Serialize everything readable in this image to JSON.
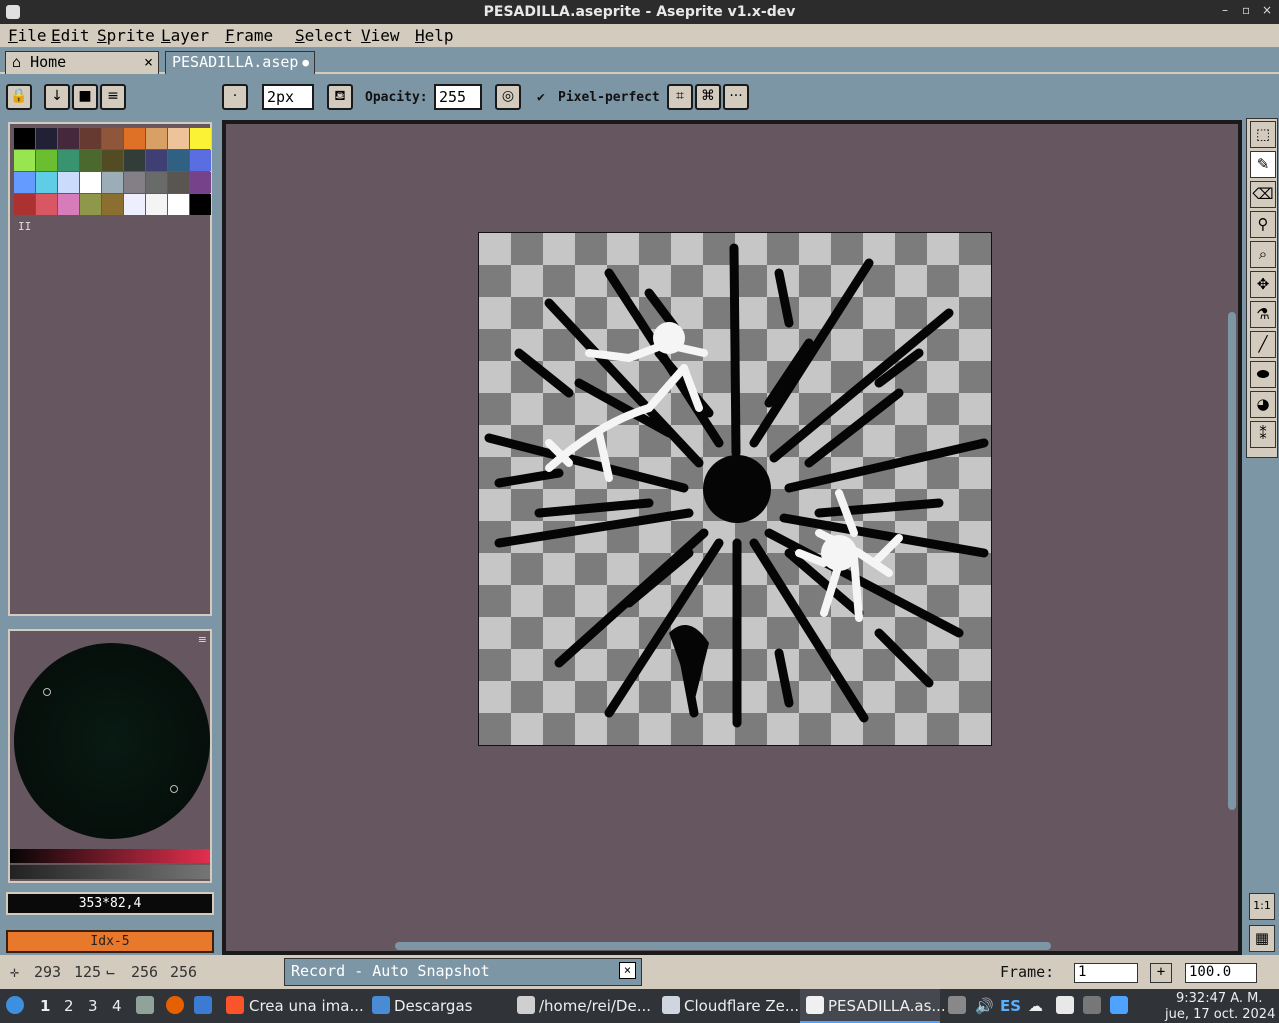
{
  "window": {
    "title": "PESADILLA.aseprite - Aseprite v1.x-dev",
    "min": "–",
    "max": "▫",
    "close": "×"
  },
  "menu": [
    "File",
    "Edit",
    "Sprite",
    "Layer",
    "Frame",
    "Select",
    "View",
    "Help"
  ],
  "tabs": {
    "home": "Home",
    "home_close": "×",
    "file": "PESADILLA.asep",
    "file_dot": "●"
  },
  "toolbar": {
    "brush_size": "2px",
    "opacity_label": "Opacity:",
    "opacity_value": "255",
    "pixel_perfect_check": "✔",
    "pixel_perfect": "Pixel-perfect",
    "more": "···"
  },
  "palette": {
    "colors": [
      "#000000",
      "#222034",
      "#45283c",
      "#663931",
      "#8f563b",
      "#df7126",
      "#d9a066",
      "#eec39a",
      "#fbf236",
      "#99e550",
      "#6abe30",
      "#37946e",
      "#4b692f",
      "#524b24",
      "#323c39",
      "#3f3f74",
      "#306082",
      "#5b6ee1",
      "#639bff",
      "#5fcde4",
      "#cbdbfc",
      "#ffffff",
      "#9badb7",
      "#847e87",
      "#696a6a",
      "#595652",
      "#76428a",
      "#ac3232",
      "#d95763",
      "#d77bba",
      "#8f974a",
      "#8a6f30",
      "#eeeeff",
      "#f4f4f4",
      "#ffffff",
      "#000000"
    ],
    "menu_icon": "II"
  },
  "color_panel": {
    "hex": "353*82,4",
    "index": "Idx-5"
  },
  "tools": [
    "rectangle-marquee",
    "pencil",
    "eraser",
    "eyedropper",
    "zoom",
    "move",
    "paint-bucket",
    "line",
    "filled-ellipse",
    "blur",
    "spray"
  ],
  "tool_glyphs": [
    "⬚",
    "✎",
    "⌫",
    "⚲",
    "⌕",
    "✥",
    "⚗",
    "╱",
    "⬬",
    "◕",
    "⁑"
  ],
  "zoom_glyphs": {
    "one_to_one": "1:1",
    "grid": "▦"
  },
  "status": {
    "cursor_x": "293",
    "cursor_y": "125",
    "size_w": "256",
    "size_h": "256",
    "record": "Record - Auto Snapshot",
    "record_close": "×",
    "frame_label": "Frame:",
    "frame_value": "1",
    "add": "+",
    "zoom": "100.0"
  },
  "taskbar": {
    "workspaces": [
      "1",
      "2",
      "3",
      "4"
    ],
    "apps": [
      {
        "label": "Crea una ima..."
      },
      {
        "label": "Descargas"
      },
      {
        "label": "/home/rei/De..."
      },
      {
        "label": "Cloudflare Ze..."
      },
      {
        "label": "PESADILLA.as..."
      }
    ],
    "lang": "ES",
    "time": "9:32:47 A. M.",
    "date": "jue, 17 oct. 2024"
  }
}
